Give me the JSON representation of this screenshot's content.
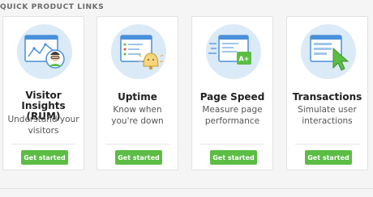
{
  "section": {
    "title": "QUICK PRODUCT LINKS"
  },
  "cards": [
    {
      "title": "Visitor Insights (RUM)",
      "description": "Understand your visitors",
      "button": "Get started",
      "icon": "visitor-insights-icon"
    },
    {
      "title": "Uptime",
      "description": "Know when you're down",
      "button": "Get started",
      "icon": "uptime-bell-icon"
    },
    {
      "title": "Page Speed",
      "description": "Measure page performance",
      "button": "Get started",
      "icon": "page-speed-icon"
    },
    {
      "title": "Transactions",
      "description": "Simulate user interactions",
      "button": "Get started",
      "icon": "transactions-cursor-icon"
    }
  ],
  "colors": {
    "accent": "#5cbd44",
    "illustration_bg": "#dbeaf7",
    "illustration_blue": "#4a90d9"
  },
  "page_speed_badge": "A+"
}
